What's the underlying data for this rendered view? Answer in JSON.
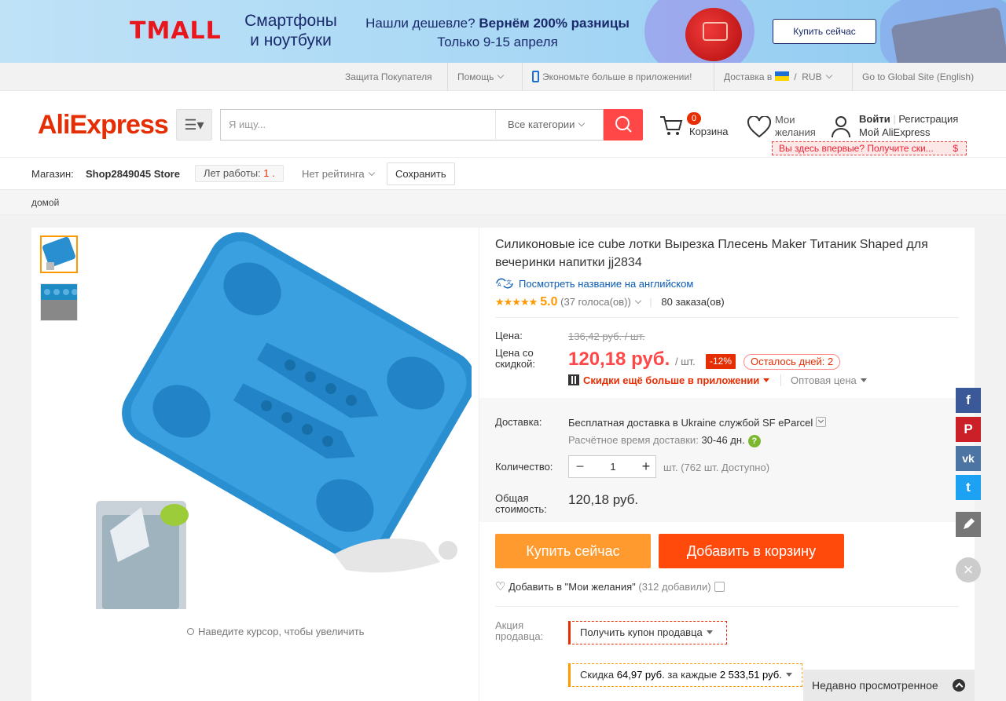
{
  "banner": {
    "brand": "TMALL",
    "line1": "Смартфоны и ноутбуки",
    "line2a": "Нашли дешевле?",
    "line2b": "Вернём 200% разницы",
    "line3": "Только 9-15 апреля",
    "cta": "Купить сейчас"
  },
  "topbar": {
    "protection": "Защита Покупателя",
    "help": "Помощь",
    "app": "Экономьте больше в приложении!",
    "delivery": "Доставка в",
    "currency": "RUB",
    "global": "Go to Global Site (English)"
  },
  "header": {
    "logo_main": "AliExpress",
    "search_placeholder": "Я ищу...",
    "category": "Все категории",
    "cart_count": "0",
    "cart_label": "Корзина",
    "wishlist_label_1": "Мои",
    "wishlist_label_2": "желания",
    "login": "Войти",
    "register": "Регистрация",
    "my_ali": "Мой AliExpress",
    "promo": "Вы здесь впервые? Получите ски...",
    "promo_icon": "$"
  },
  "store": {
    "label": "Магазин:",
    "name": "Shop2849045 Store",
    "years_label": "Лет работы:",
    "years": "1",
    "rating": "Нет рейтинга",
    "save": "Сохранить"
  },
  "breadcrumb": "домой",
  "product": {
    "title": "Силиконовые ice cube лотки Вырезка Плесень Maker Титаник Shaped для вечеринки напитки jj2834",
    "translate": "Посмотреть название на английском",
    "stars": "★★★★★",
    "score": "5.0",
    "votes": "(37 голоса(ов))",
    "orders": "80 заказа(ов)",
    "price_label": "Цена:",
    "old_price": "136,42 руб. / шт.",
    "disc_price_label_1": "Цена со",
    "disc_price_label_2": "скидкой:",
    "new_price": "120,18 руб.",
    "unit": "/ шт.",
    "discount": "-12%",
    "days_left": "Осталось дней: 2",
    "app_discount": "Скидки ещё больше в приложении",
    "wholesale": "Оптовая цена",
    "zoom_hint": "Наведите курсор, чтобы увеличить"
  },
  "shipping": {
    "label": "Доставка:",
    "text_a": "Бесплатная доставка в",
    "text_b": "Ukraine службой SF eParcel",
    "eta_label": "Расчётное время доставки:",
    "eta": "30-46 дн.",
    "eta_help": "?"
  },
  "quantity": {
    "label": "Количество:",
    "value": "1",
    "minus": "−",
    "plus": "+",
    "unit": "шт.",
    "available": "(762 шт. Доступно)"
  },
  "total": {
    "label": "Общая стоимость:",
    "value": "120,18 руб."
  },
  "actions": {
    "buy_now": "Купить сейчас",
    "add_to_cart": "Добавить в корзину",
    "add_wish": "Добавить в \"Мои желания\"",
    "wish_count": "(312 добавили)"
  },
  "promotions": {
    "label": "Акция продавца:",
    "coupon": "Получить купон продавца",
    "discount_a": "Скидка",
    "discount_b": "64,97 руб.",
    "discount_c": "за каждые",
    "discount_d": "2 533,51 руб."
  },
  "recent": "Недавно просмотренное",
  "social": {
    "facebook": "f",
    "pinterest": "P",
    "vk": "vk",
    "twitter": "t",
    "close": "×"
  },
  "colors": {
    "accent": "#ff4747",
    "buy_now": "#ff9a2f",
    "add_to_cart": "#ff4a0c",
    "facebook": "#3b5998",
    "pinterest": "#cb2027",
    "vk": "#4c75a3",
    "twitter": "#1da1f2",
    "edit": "#777777"
  }
}
